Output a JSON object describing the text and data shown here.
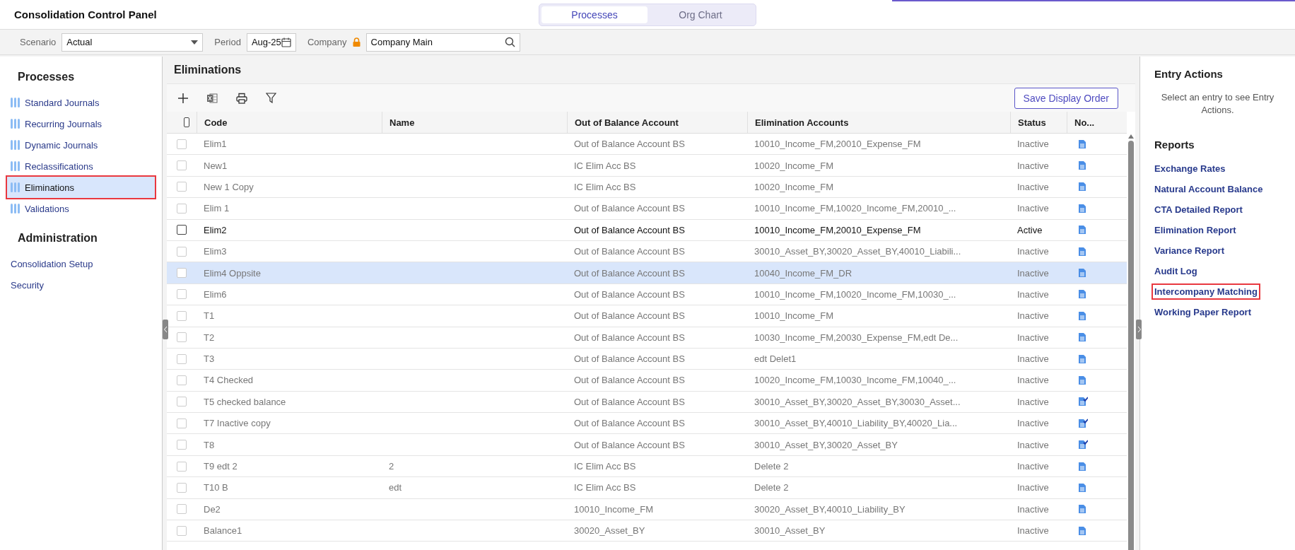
{
  "header": {
    "title": "Consolidation Control Panel",
    "view_tabs": [
      {
        "label": "Processes",
        "selected": true
      },
      {
        "label": "Org Chart",
        "selected": false
      }
    ]
  },
  "filters": [
    {
      "kind": "select",
      "label": "Scenario",
      "value": "Actual"
    },
    {
      "kind": "date",
      "label": "Period",
      "value": "Aug-25"
    },
    {
      "kind": "lookup",
      "label": "Company",
      "value": "Company Main",
      "locked": true
    }
  ],
  "sidebar": [
    {
      "title": "Processes",
      "items": [
        {
          "kind": "process",
          "label": "Standard Journals",
          "selected": false,
          "highlighted": false
        },
        {
          "kind": "process",
          "label": "Recurring Journals",
          "selected": false,
          "highlighted": false
        },
        {
          "kind": "process",
          "label": "Dynamic Journals",
          "selected": false,
          "highlighted": false
        },
        {
          "kind": "process",
          "label": "Reclassifications",
          "selected": false,
          "highlighted": false
        },
        {
          "kind": "process",
          "label": "Eliminations",
          "selected": true,
          "highlighted": true
        },
        {
          "kind": "process",
          "label": "Validations",
          "selected": false,
          "highlighted": false
        }
      ]
    },
    {
      "title": "Administration",
      "items": [
        {
          "kind": "link",
          "label": "Consolidation Setup",
          "selected": false,
          "highlighted": false
        },
        {
          "kind": "link",
          "label": "Security",
          "selected": false,
          "highlighted": false
        }
      ]
    }
  ],
  "main": {
    "title": "Eliminations",
    "save_button": "Save Display Order",
    "all_checked": false,
    "columns": [
      "Code",
      "Name",
      "Out of Balance Account",
      "Elimination Accounts",
      "Status",
      "No..."
    ],
    "rows": [
      {
        "code": "Elim1",
        "name": "",
        "out_of_balance_account": "Out of Balance Account BS",
        "elimination_accounts": "10010_Income_FM,20010_Expense_FM",
        "status": "Inactive",
        "active": false,
        "checked": false,
        "selected": false,
        "note_checked": false
      },
      {
        "code": "New1",
        "name": "",
        "out_of_balance_account": "IC Elim Acc BS",
        "elimination_accounts": "10020_Income_FM",
        "status": "Inactive",
        "active": false,
        "checked": false,
        "selected": false,
        "note_checked": false
      },
      {
        "code": "New 1 Copy",
        "name": "",
        "out_of_balance_account": "IC Elim Acc BS",
        "elimination_accounts": "10020_Income_FM",
        "status": "Inactive",
        "active": false,
        "checked": false,
        "selected": false,
        "note_checked": false
      },
      {
        "code": "Elim 1",
        "name": "",
        "out_of_balance_account": "Out of Balance Account BS",
        "elimination_accounts": "10010_Income_FM,10020_Income_FM,20010_...",
        "status": "Inactive",
        "active": false,
        "checked": false,
        "selected": false,
        "note_checked": false
      },
      {
        "code": "Elim2",
        "name": "",
        "out_of_balance_account": "Out of Balance Account BS",
        "elimination_accounts": "10010_Income_FM,20010_Expense_FM",
        "status": "Active",
        "active": true,
        "checked": false,
        "selected": false,
        "note_checked": false
      },
      {
        "code": "Elim3",
        "name": "",
        "out_of_balance_account": "Out of Balance Account BS",
        "elimination_accounts": "30010_Asset_BY,30020_Asset_BY,40010_Liabili...",
        "status": "Inactive",
        "active": false,
        "checked": false,
        "selected": false,
        "note_checked": false
      },
      {
        "code": "Elim4 Oppsite",
        "name": "",
        "out_of_balance_account": "Out of Balance Account BS",
        "elimination_accounts": "10040_Income_FM_DR",
        "status": "Inactive",
        "active": false,
        "checked": false,
        "selected": true,
        "note_checked": false
      },
      {
        "code": "Elim6",
        "name": "",
        "out_of_balance_account": "Out of Balance Account BS",
        "elimination_accounts": "10010_Income_FM,10020_Income_FM,10030_...",
        "status": "Inactive",
        "active": false,
        "checked": false,
        "selected": false,
        "note_checked": false
      },
      {
        "code": "T1",
        "name": "",
        "out_of_balance_account": "Out of Balance Account BS",
        "elimination_accounts": "10010_Income_FM",
        "status": "Inactive",
        "active": false,
        "checked": false,
        "selected": false,
        "note_checked": false
      },
      {
        "code": "T2",
        "name": "",
        "out_of_balance_account": "Out of Balance Account BS",
        "elimination_accounts": "10030_Income_FM,20030_Expense_FM,edt De...",
        "status": "Inactive",
        "active": false,
        "checked": false,
        "selected": false,
        "note_checked": false
      },
      {
        "code": "T3",
        "name": "",
        "out_of_balance_account": "Out of Balance Account BS",
        "elimination_accounts": "edt Delet1",
        "status": "Inactive",
        "active": false,
        "checked": false,
        "selected": false,
        "note_checked": false
      },
      {
        "code": "T4 Checked",
        "name": "",
        "out_of_balance_account": "Out of Balance Account BS",
        "elimination_accounts": "10020_Income_FM,10030_Income_FM,10040_...",
        "status": "Inactive",
        "active": false,
        "checked": false,
        "selected": false,
        "note_checked": false
      },
      {
        "code": "T5 checked balance",
        "name": "",
        "out_of_balance_account": "Out of Balance Account BS",
        "elimination_accounts": "30010_Asset_BY,30020_Asset_BY,30030_Asset...",
        "status": "Inactive",
        "active": false,
        "checked": false,
        "selected": false,
        "note_checked": true
      },
      {
        "code": "T7 Inactive copy",
        "name": "",
        "out_of_balance_account": "Out of Balance Account BS",
        "elimination_accounts": "30010_Asset_BY,40010_Liability_BY,40020_Lia...",
        "status": "Inactive",
        "active": false,
        "checked": false,
        "selected": false,
        "note_checked": true
      },
      {
        "code": "T8",
        "name": "",
        "out_of_balance_account": "Out of Balance Account BS",
        "elimination_accounts": "30010_Asset_BY,30020_Asset_BY",
        "status": "Inactive",
        "active": false,
        "checked": false,
        "selected": false,
        "note_checked": true
      },
      {
        "code": "T9 edt 2",
        "name": "2",
        "out_of_balance_account": "IC Elim Acc BS",
        "elimination_accounts": "Delete 2",
        "status": "Inactive",
        "active": false,
        "checked": false,
        "selected": false,
        "note_checked": false
      },
      {
        "code": "T10 B",
        "name": "edt",
        "out_of_balance_account": "IC Elim Acc BS",
        "elimination_accounts": "Delete 2",
        "status": "Inactive",
        "active": false,
        "checked": false,
        "selected": false,
        "note_checked": false
      },
      {
        "code": "De2",
        "name": "",
        "out_of_balance_account": "10010_Income_FM",
        "elimination_accounts": "30020_Asset_BY,40010_Liability_BY",
        "status": "Inactive",
        "active": false,
        "checked": false,
        "selected": false,
        "note_checked": false
      },
      {
        "code": "Balance1",
        "name": "",
        "out_of_balance_account": "30020_Asset_BY",
        "elimination_accounts": "30010_Asset_BY",
        "status": "Inactive",
        "active": false,
        "checked": false,
        "selected": false,
        "note_checked": false
      }
    ]
  },
  "entry_actions": {
    "title": "Entry Actions",
    "message": "Select an entry to see Entry Actions."
  },
  "reports": {
    "title": "Reports",
    "items": [
      {
        "label": "Exchange Rates",
        "highlighted": false
      },
      {
        "label": "Natural Account Balance",
        "highlighted": false
      },
      {
        "label": "CTA Detailed Report",
        "highlighted": false
      },
      {
        "label": "Elimination Report",
        "highlighted": false
      },
      {
        "label": "Variance Report",
        "highlighted": false
      },
      {
        "label": "Audit Log",
        "highlighted": false
      },
      {
        "label": "Intercompany Matching",
        "highlighted": true
      },
      {
        "label": "Working Paper Report",
        "highlighted": false
      }
    ]
  }
}
